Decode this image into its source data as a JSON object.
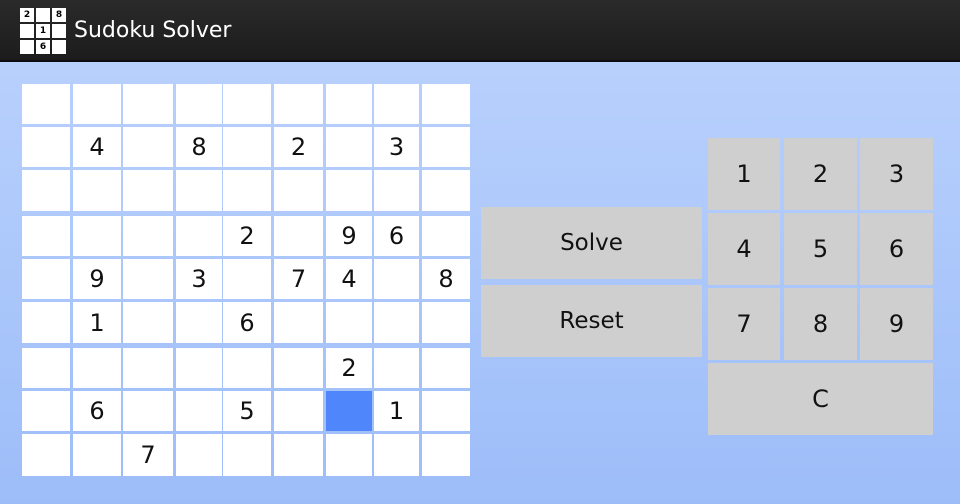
{
  "app": {
    "title": "Sudoku Solver",
    "icon_digits": [
      "2",
      "",
      "8",
      "",
      "1",
      "",
      "",
      "6",
      ""
    ]
  },
  "colors": {
    "action_bar": "#1f1f1f",
    "background_top": "#b8d0fc",
    "background_bottom": "#9dbdf9",
    "cell": "#ffffff",
    "selected_cell": "#4f86fb",
    "button": "#cfcfcf"
  },
  "board": {
    "rows": [
      [
        "",
        "",
        "",
        "",
        "",
        "",
        "",
        "",
        ""
      ],
      [
        "",
        "4",
        "",
        "8",
        "",
        "2",
        "",
        "3",
        ""
      ],
      [
        "",
        "",
        "",
        "",
        "",
        "",
        "",
        "",
        ""
      ],
      [
        "",
        "",
        "",
        "",
        "2",
        "",
        "9",
        "6",
        ""
      ],
      [
        "",
        "9",
        "",
        "3",
        "",
        "7",
        "4",
        "",
        "8"
      ],
      [
        "",
        "1",
        "",
        "",
        "6",
        "",
        "",
        "",
        ""
      ],
      [
        "",
        "",
        "",
        "",
        "",
        "",
        "2",
        "",
        ""
      ],
      [
        "",
        "6",
        "",
        "",
        "5",
        "",
        "",
        "1",
        ""
      ],
      [
        "",
        "",
        "7",
        "",
        "",
        "",
        "",
        "",
        ""
      ]
    ],
    "selected": {
      "row": 7,
      "col": 6
    }
  },
  "actions": {
    "solve_label": "Solve",
    "reset_label": "Reset"
  },
  "keypad": {
    "keys": [
      "1",
      "2",
      "3",
      "4",
      "5",
      "6",
      "7",
      "8",
      "9"
    ],
    "clear_label": "C"
  }
}
